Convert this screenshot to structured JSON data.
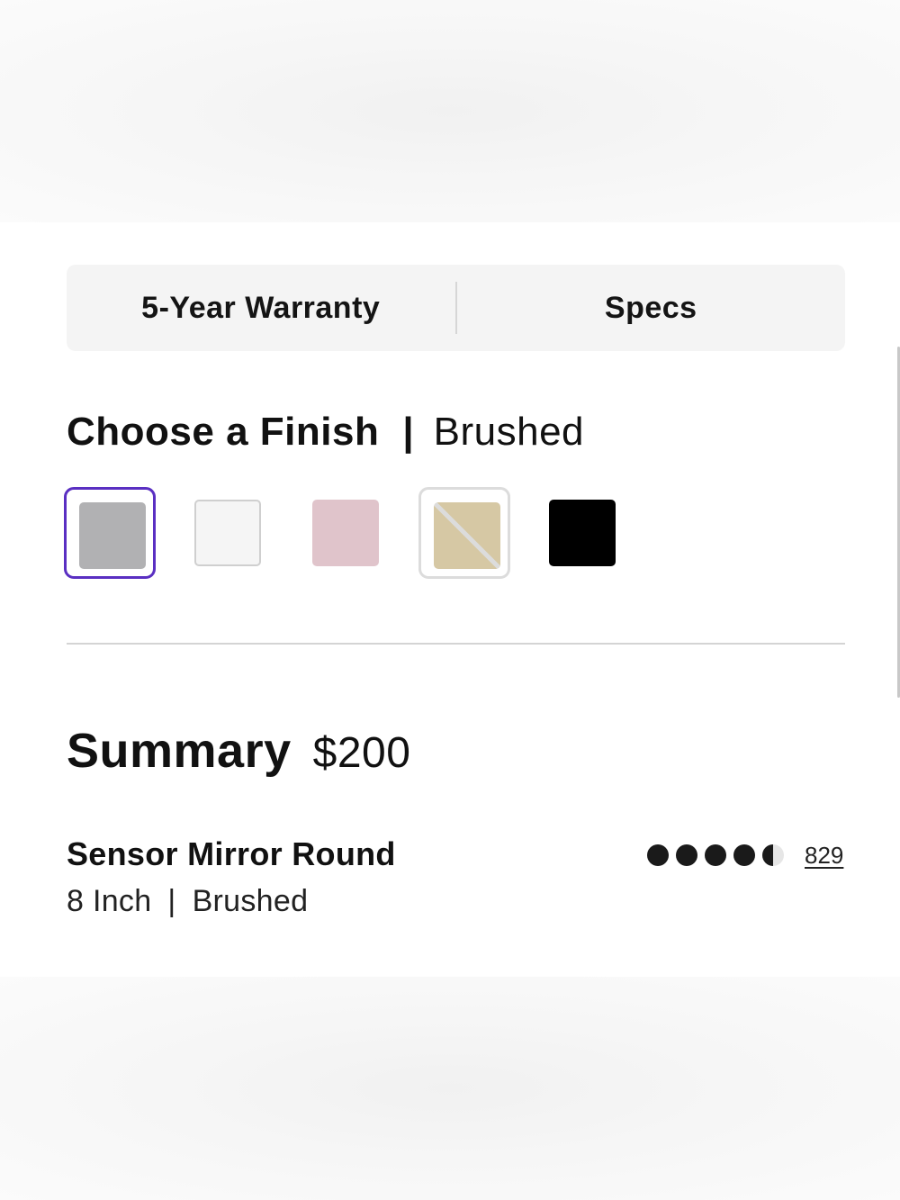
{
  "tabs": [
    {
      "label": "5-Year Warranty"
    },
    {
      "label": "Specs"
    }
  ],
  "finish": {
    "heading": "Choose a Finish",
    "separator": "|",
    "selected_value": "Brushed",
    "swatches": [
      {
        "name": "Brushed",
        "color": "#b1b1b3",
        "state": "selected"
      },
      {
        "name": "White",
        "color": "#f5f5f5",
        "state": "available"
      },
      {
        "name": "Pink",
        "color": "#e0c4cb",
        "state": "available"
      },
      {
        "name": "Gold",
        "color": "#d6c8a4",
        "state": "unavailable"
      },
      {
        "name": "Black",
        "color": "#000000",
        "state": "available"
      }
    ]
  },
  "summary": {
    "title": "Summary",
    "price": "$200"
  },
  "product": {
    "name": "Sensor Mirror Round",
    "size": "8 Inch",
    "separator": "|",
    "finish": "Brushed",
    "rating": 4.5,
    "rating_max": 5,
    "review_count": "829"
  },
  "colors": {
    "accent": "#5a2fc2",
    "text": "#111111",
    "tab_background": "#f4f4f4",
    "rating_dot": "#1a1a1a"
  }
}
